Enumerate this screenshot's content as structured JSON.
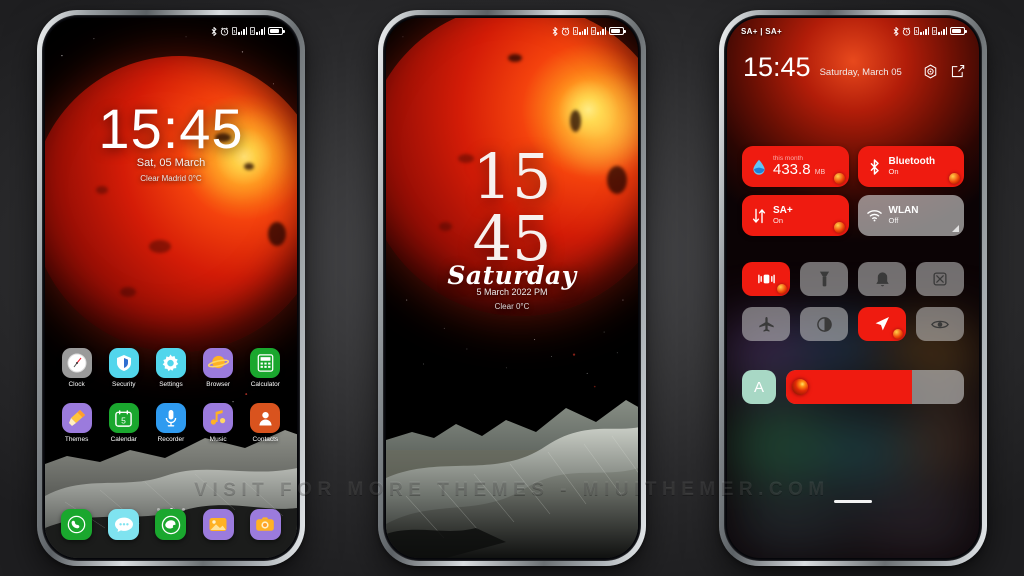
{
  "watermark": "VISIT FOR MORE THEMES - MIUITHEMER.COM",
  "phone1": {
    "status_bar": {
      "left": "",
      "icons": [
        "bluetooth-icon",
        "alarm-icon",
        "sim1-signal-icon",
        "sim2-signal-icon",
        "battery-icon"
      ]
    },
    "lockscreen": {
      "time": "15:45",
      "date": "Sat, 05 March",
      "weather": "Clear Madrid 0°C"
    },
    "apps_row1": [
      {
        "label": "Clock",
        "icon": "clock-icon",
        "bg": "#9a9a9a"
      },
      {
        "label": "Security",
        "icon": "shield-icon",
        "bg": "#52d6ec"
      },
      {
        "label": "Settings",
        "icon": "gear-icon",
        "bg": "#52d6ec"
      },
      {
        "label": "Browser",
        "icon": "browser-icon",
        "bg": "#9b7bdd"
      },
      {
        "label": "Calculator",
        "icon": "calculator-icon",
        "bg": "#1aa72e"
      }
    ],
    "apps_row2": [
      {
        "label": "Themes",
        "icon": "paintbrush-icon",
        "bg": "#9b7bdd"
      },
      {
        "label": "Calendar",
        "icon": "calendar-icon",
        "bg": "#1aa72e",
        "day": "5"
      },
      {
        "label": "Recorder",
        "icon": "microphone-icon",
        "bg": "#2f9bf0"
      },
      {
        "label": "Music",
        "icon": "music-note-icon",
        "bg": "#9b7bdd"
      },
      {
        "label": "Contacts",
        "icon": "contact-person-icon",
        "bg": "#d9531e"
      }
    ],
    "dock": [
      {
        "label": "Phone",
        "icon": "phone-handset-icon",
        "bg": "#1aa72e"
      },
      {
        "label": "Messages",
        "icon": "message-bubble-icon",
        "bg": "#7fe3f0"
      },
      {
        "label": "WeChat",
        "icon": "chat-icon",
        "bg": "#1aa72e"
      },
      {
        "label": "Gallery",
        "icon": "gallery-image-icon",
        "bg": "#9b7bdd"
      },
      {
        "label": "Camera",
        "icon": "camera-icon",
        "bg": "#9b7bdd"
      }
    ],
    "page_dots": {
      "count": 3,
      "active": 1
    }
  },
  "phone2": {
    "lockscreen": {
      "hour": "15",
      "minute": "45",
      "day": "Saturday",
      "date": "5 March 2022  PM",
      "weather": "Clear 0°C"
    }
  },
  "phone3": {
    "status_bar": {
      "left": "SA+ | SA+",
      "icons": [
        "bluetooth-icon",
        "alarm-icon",
        "sim1-signal-icon",
        "sim2-signal-icon",
        "battery-icon"
      ]
    },
    "header": {
      "time": "15:45",
      "date": "Saturday, March 05",
      "settings_icon": "gear-icon",
      "edit_icon": "edit-icon"
    },
    "tiles": [
      {
        "name": "mobile-data",
        "top": "this month",
        "value": "433.8",
        "unit": "MB",
        "icon": "water-drop-icon",
        "state": "on"
      },
      {
        "name": "bluetooth",
        "title": "Bluetooth",
        "sub": "On",
        "icon": "bluetooth-icon",
        "state": "on"
      },
      {
        "name": "sa-plus",
        "title": "SA+",
        "sub": "On",
        "icon": "data-arrows-icon",
        "state": "on"
      },
      {
        "name": "wlan",
        "title": "WLAN",
        "sub": "Off",
        "icon": "wifi-icon",
        "state": "off"
      }
    ],
    "toggles": [
      {
        "name": "vibrate",
        "icon": "vibrate-icon",
        "state": "on"
      },
      {
        "name": "flashlight",
        "icon": "flashlight-icon",
        "state": "off"
      },
      {
        "name": "ringer",
        "icon": "bell-icon",
        "state": "off"
      },
      {
        "name": "screenshot",
        "icon": "screenshot-crop-icon",
        "state": "off"
      },
      {
        "name": "airplane-mode",
        "icon": "airplane-icon",
        "state": "off"
      },
      {
        "name": "dark-mode",
        "icon": "contrast-icon",
        "state": "off"
      },
      {
        "name": "location",
        "icon": "location-arrow-icon",
        "state": "on"
      },
      {
        "name": "reading-mode",
        "icon": "eye-icon",
        "state": "off"
      }
    ],
    "brightness": {
      "auto_label": "A",
      "level_percent": 71
    }
  },
  "colors": {
    "accent_red": "#ef1b10",
    "tile_off": "#c8c8c8",
    "auto_green": "#a8d8c5"
  }
}
